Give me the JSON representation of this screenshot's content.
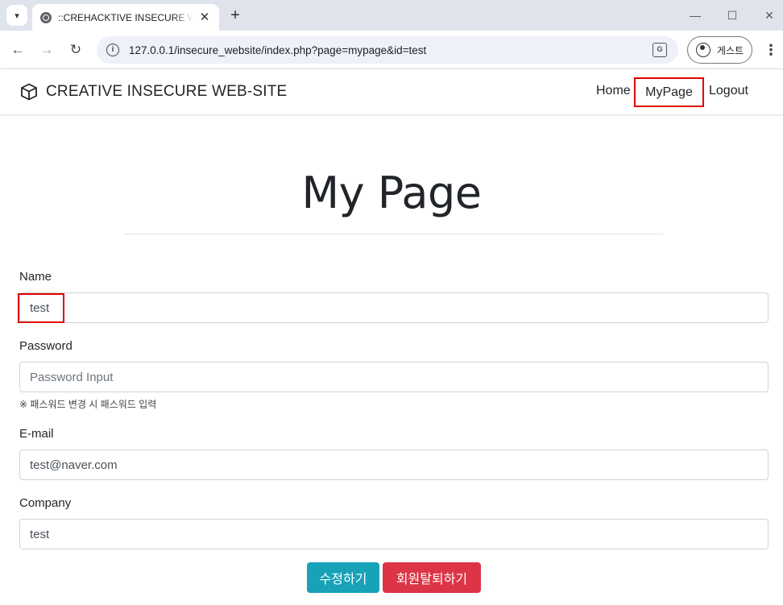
{
  "browser": {
    "tab_title": "::CREHACKTIVE INSECURE WEB-SITE::",
    "url": "127.0.0.1/insecure_website/index.php?page=mypage&id=test",
    "profile_label": "게스트"
  },
  "navbar": {
    "brand": "CREATIVE INSECURE WEB-SITE",
    "links": [
      "Home",
      "MyPage",
      "Logout"
    ]
  },
  "main": {
    "title": "My Page",
    "fields": {
      "name": {
        "label": "Name",
        "value": "test"
      },
      "password": {
        "label": "Password",
        "placeholder": "Password Input",
        "hint": "※ 패스워드 변경 시 패스워드 입력"
      },
      "email": {
        "label": "E-mail",
        "value": "test@naver.com"
      },
      "company": {
        "label": "Company",
        "value": "test"
      }
    },
    "buttons": {
      "edit": "수정하기",
      "withdraw": "회원탈퇴하기"
    }
  },
  "colors": {
    "edit_button": "#17a2b8",
    "withdraw_button": "#dc3545",
    "highlight_box": "#e00000"
  },
  "icons": [
    "tab-search-icon",
    "globe-favicon-icon",
    "close-icon",
    "plus-icon",
    "minimize-icon",
    "maximize-icon",
    "window-close-icon",
    "back-arrow-icon",
    "forward-arrow-icon",
    "reload-icon",
    "site-info-icon",
    "translate-icon",
    "profile-icon",
    "more-menu-icon",
    "cube-icon"
  ]
}
